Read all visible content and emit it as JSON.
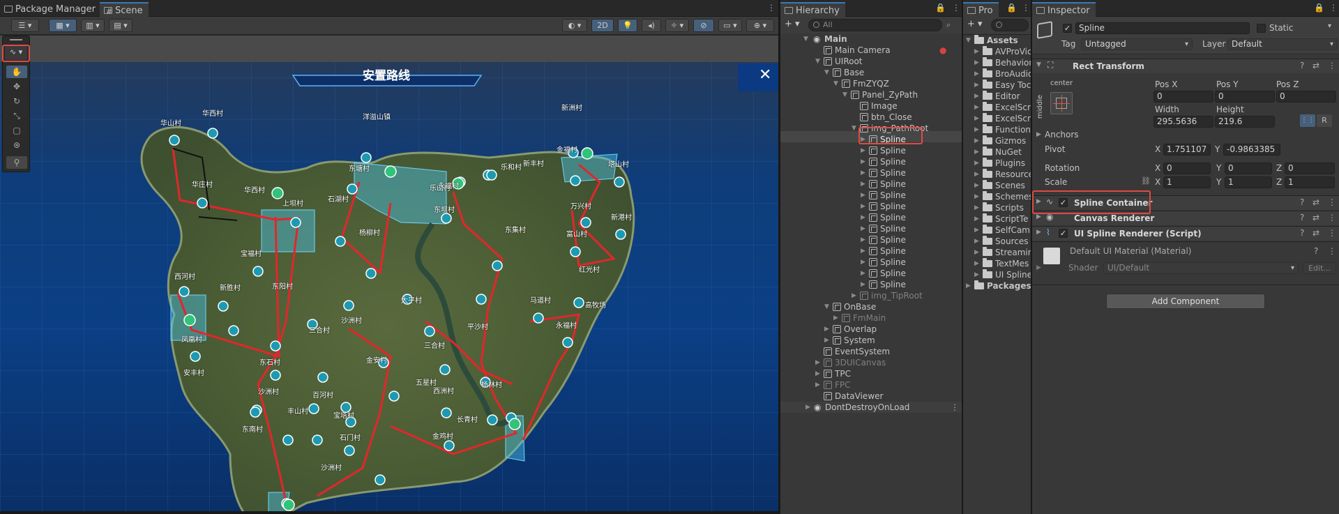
{
  "left_tabs": {
    "package_manager": "Package Manager",
    "scene": "Scene"
  },
  "scene_toolbar": {
    "mode_2d": "2D"
  },
  "scene_view": {
    "map_title": "安置路线",
    "close_glyph": "✕",
    "villages": [
      {
        "name": "华西村"
      },
      {
        "name": "华山村"
      },
      {
        "name": "华庄村"
      },
      {
        "name": "华西村"
      },
      {
        "name": "上坝村"
      },
      {
        "name": "石湖村"
      },
      {
        "name": "东塘村"
      },
      {
        "name": "洋溢山镇"
      },
      {
        "name": "乐山村"
      },
      {
        "name": "新洲村"
      },
      {
        "name": "杨柳村"
      },
      {
        "name": "永福村"
      },
      {
        "name": "东坝村"
      },
      {
        "name": "乐和村"
      },
      {
        "name": "新丰村"
      },
      {
        "name": "金福村"
      },
      {
        "name": "塔山村"
      },
      {
        "name": "万兴村"
      },
      {
        "name": "新港村"
      },
      {
        "name": "富山村"
      },
      {
        "name": "东集村"
      },
      {
        "name": "红光村"
      },
      {
        "name": "马道村"
      },
      {
        "name": "永福村"
      },
      {
        "name": "宝福村"
      },
      {
        "name": "西河村"
      },
      {
        "name": "新胜村"
      },
      {
        "name": "东阳村"
      },
      {
        "name": "沙洲村"
      },
      {
        "name": "太平村"
      },
      {
        "name": "平沙村"
      },
      {
        "name": "三合村"
      },
      {
        "name": "凤凰村"
      },
      {
        "name": "三合村"
      },
      {
        "name": "杨林村"
      },
      {
        "name": "金安村"
      },
      {
        "name": "东石村"
      },
      {
        "name": "高牧场"
      },
      {
        "name": "沙洲村"
      },
      {
        "name": "百河村"
      },
      {
        "name": "五星村"
      },
      {
        "name": "西洲村"
      },
      {
        "name": "长青村"
      },
      {
        "name": "丰山村"
      },
      {
        "name": "宝塔村"
      },
      {
        "name": "安丰村"
      },
      {
        "name": "石门村"
      },
      {
        "name": "金鸡村"
      },
      {
        "name": "东南村"
      },
      {
        "name": "沙洲村"
      }
    ]
  },
  "hierarchy": {
    "tab": "Hierarchy",
    "search_placeholder": "All",
    "items": [
      {
        "label": "Main"
      },
      {
        "label": "Main Camera"
      },
      {
        "label": "UIRoot"
      },
      {
        "label": "Base"
      },
      {
        "label": "FmZYQZ"
      },
      {
        "label": "Panel_ZyPath"
      },
      {
        "label": "Image"
      },
      {
        "label": "btn_Close"
      },
      {
        "label": "img_PathRoot"
      },
      {
        "label": "Spline"
      },
      {
        "label": "Spline"
      },
      {
        "label": "Spline"
      },
      {
        "label": "Spline"
      },
      {
        "label": "Spline"
      },
      {
        "label": "Spline"
      },
      {
        "label": "Spline"
      },
      {
        "label": "Spline"
      },
      {
        "label": "Spline"
      },
      {
        "label": "Spline"
      },
      {
        "label": "Spline"
      },
      {
        "label": "Spline"
      },
      {
        "label": "Spline"
      },
      {
        "label": "Spline"
      },
      {
        "label": "img_TipRoot"
      },
      {
        "label": "OnBase"
      },
      {
        "label": "FmMain"
      },
      {
        "label": "Overlap"
      },
      {
        "label": "System"
      },
      {
        "label": "EventSystem"
      },
      {
        "label": "3DUICanvas"
      },
      {
        "label": "TPC"
      },
      {
        "label": "FPC"
      },
      {
        "label": "DataViewer"
      },
      {
        "label": "DontDestroyOnLoad"
      }
    ]
  },
  "project": {
    "tab": "Pro",
    "items": [
      {
        "label": "Assets"
      },
      {
        "label": "AVProVic"
      },
      {
        "label": "Behavior"
      },
      {
        "label": "BroAudio"
      },
      {
        "label": "Easy Toc"
      },
      {
        "label": "Editor"
      },
      {
        "label": "ExcelScr"
      },
      {
        "label": "ExcelScr"
      },
      {
        "label": "Function"
      },
      {
        "label": "Gizmos"
      },
      {
        "label": "NuGet"
      },
      {
        "label": "Plugins"
      },
      {
        "label": "Resource"
      },
      {
        "label": "Scenes"
      },
      {
        "label": "Schemes"
      },
      {
        "label": "Scripts"
      },
      {
        "label": "ScriptTe"
      },
      {
        "label": "SelfCam"
      },
      {
        "label": "Sources"
      },
      {
        "label": "Streamin"
      },
      {
        "label": "TextMes"
      },
      {
        "label": "UI Spline"
      },
      {
        "label": "Packages"
      }
    ]
  },
  "inspector": {
    "tab": "Inspector",
    "object_name": "Spline",
    "static_label": "Static",
    "tag_label": "Tag",
    "tag_value": "Untagged",
    "layer_label": "Layer",
    "layer_value": "Default",
    "rect_transform": {
      "title": "Rect Transform",
      "anchor_h": "center",
      "anchor_v": "middle",
      "posx_label": "Pos X",
      "posy_label": "Pos Y",
      "posz_label": "Pos Z",
      "posx": "0",
      "posy": "0",
      "posz": "0",
      "width_label": "Width",
      "height_label": "Height",
      "width": "295.5636",
      "height": "219.6",
      "r_button": "R",
      "anchors_label": "Anchors",
      "pivot_label": "Pivot",
      "pivot_x": "1.751107",
      "pivot_y": "-0.9863385",
      "rotation_label": "Rotation",
      "rot_x": "0",
      "rot_y": "0",
      "rot_z": "0",
      "scale_label": "Scale",
      "scale_x": "1",
      "scale_y": "1",
      "scale_z": "1",
      "x": "X",
      "y": "Y",
      "z": "Z"
    },
    "components": {
      "spline_container": "Spline Container",
      "canvas_renderer": "Canvas Renderer",
      "ui_spline_renderer": "UI Spline Renderer (Script)"
    },
    "material": {
      "name": "Default UI Material (Material)",
      "shader_label": "Shader",
      "shader_value": "UI/Default",
      "edit": "Edit..."
    },
    "add_component": "Add Component"
  },
  "colors": {
    "accent": "#3a79bb",
    "highlight_red": "#e04a43",
    "route_red": "#e3262b",
    "zone_blue": "#4cc3e6"
  }
}
